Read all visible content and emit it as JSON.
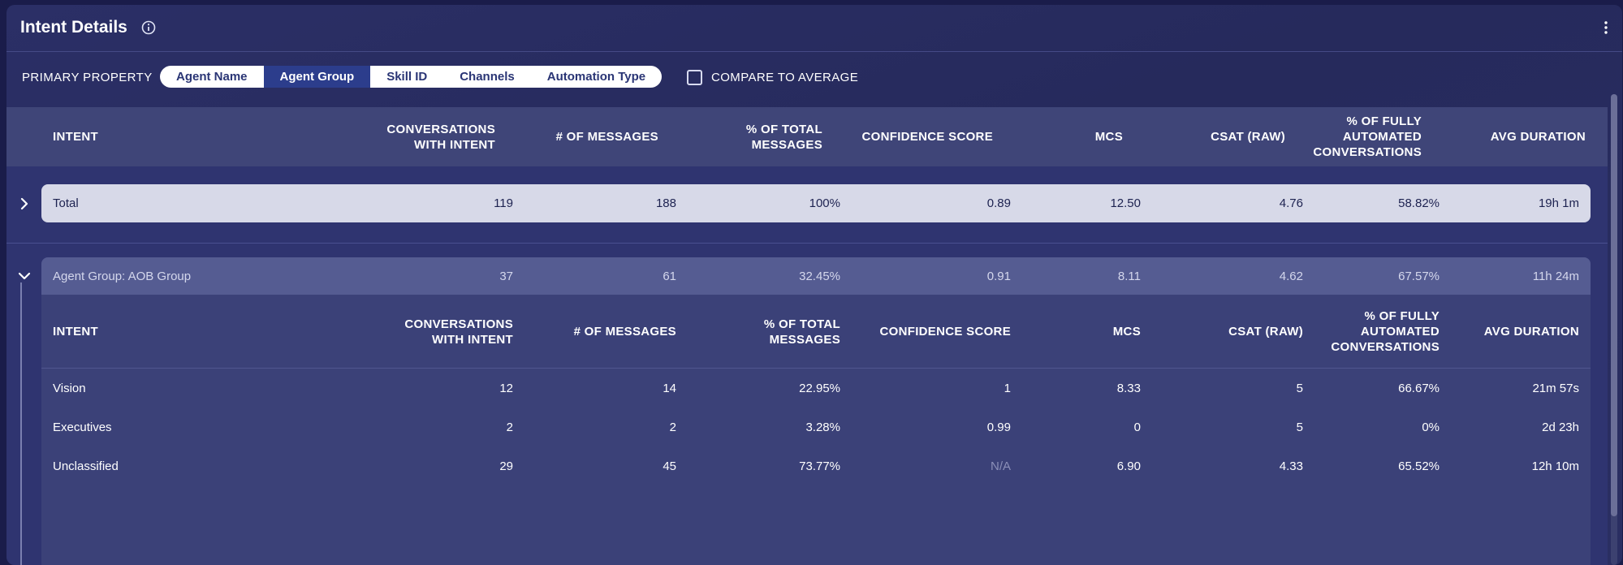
{
  "header": {
    "title": "Intent Details",
    "info_icon": "info-circle-icon",
    "menu_icon": "kebab-menu-icon"
  },
  "filters": {
    "primary_label": "PRIMARY PROPERTY",
    "options": [
      "Agent Name",
      "Agent Group",
      "Skill ID",
      "Channels",
      "Automation Type"
    ],
    "active": "Agent Group",
    "compare_label": "COMPARE TO AVERAGE",
    "compare_checked": false
  },
  "columns": {
    "intent": "INTENT",
    "conversations_1": "CONVERSATIONS",
    "conversations_2": "WITH INTENT",
    "messages": "# OF MESSAGES",
    "pct_total_1": "% OF TOTAL",
    "pct_total_2": "MESSAGES",
    "confidence": "CONFIDENCE SCORE",
    "mcs": "MCS",
    "csat": "CSAT (RAW)",
    "fully_auto_1": "% OF FULLY",
    "fully_auto_2": "AUTOMATED",
    "fully_auto_3": "CONVERSATIONS",
    "avg_duration": "AVG DURATION"
  },
  "total": {
    "label": "Total",
    "conversations": "119",
    "messages": "188",
    "pct_total": "100%",
    "confidence": "0.89",
    "mcs": "12.50",
    "csat": "4.76",
    "fully_auto": "58.82%",
    "avg_duration": "19h 1m"
  },
  "group": {
    "label": "Agent Group: AOB Group",
    "conversations": "37",
    "messages": "61",
    "pct_total": "32.45%",
    "confidence": "0.91",
    "mcs": "8.11",
    "csat": "4.62",
    "fully_auto": "67.57%",
    "avg_duration": "11h 24m",
    "rows": [
      {
        "intent": "Vision",
        "conversations": "12",
        "messages": "14",
        "pct_total": "22.95%",
        "confidence": "1",
        "mcs": "8.33",
        "csat": "5",
        "fully_auto": "66.67%",
        "avg_duration": "21m 57s"
      },
      {
        "intent": "Executives",
        "conversations": "2",
        "messages": "2",
        "pct_total": "3.28%",
        "confidence": "0.99",
        "mcs": "0",
        "csat": "5",
        "fully_auto": "0%",
        "avg_duration": "2d 23h"
      },
      {
        "intent": "Unclassified",
        "conversations": "29",
        "messages": "45",
        "pct_total": "73.77%",
        "confidence": "N/A",
        "mcs": "6.90",
        "csat": "4.33",
        "fully_auto": "65.52%",
        "avg_duration": "12h 10m"
      }
    ]
  }
}
